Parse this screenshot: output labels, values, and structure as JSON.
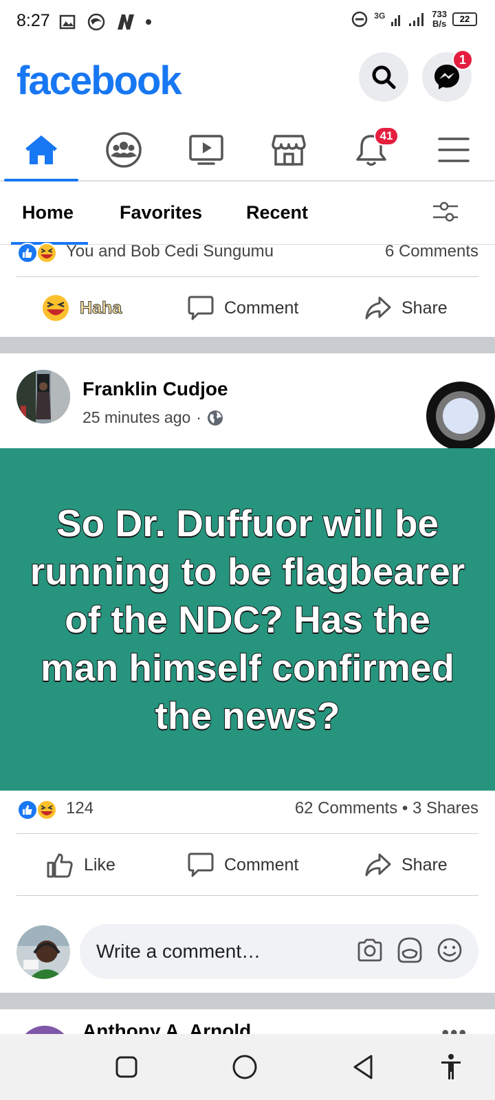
{
  "status_bar": {
    "time": "8:27",
    "network": "3G",
    "speed_value": "733",
    "speed_unit": "B/s",
    "battery": "22"
  },
  "header": {
    "logo": "facebook",
    "messenger_badge": "1",
    "brand_color": "#1877f2"
  },
  "nav": {
    "notifications_badge": "41",
    "icons": [
      "home-icon",
      "groups-icon",
      "watch-icon",
      "marketplace-icon",
      "bell-icon",
      "menu-icon"
    ]
  },
  "feed_tabs": {
    "home": "Home",
    "favorites": "Favorites",
    "recent": "Recent"
  },
  "previous_post": {
    "reactors": "You and Bob Cedi Sungumu",
    "comments": "6 Comments",
    "reaction_label": "Haha",
    "comment_label": "Comment",
    "share_label": "Share"
  },
  "post": {
    "author": "Franklin Cudjoe",
    "time": "25 minutes ago",
    "separator": "·",
    "text": "So Dr. Duffuor will be running to be flagbearer of the NDC? Has the man himself confirmed the news?",
    "background_color": "#27947e",
    "reaction_count": "124",
    "comments_shares": "62 Comments • 3 Shares",
    "like_label": "Like",
    "comment_label": "Comment",
    "share_label": "Share",
    "comment_placeholder": "Write a comment…"
  },
  "next_post": {
    "author": "Anthony A. Arnold"
  }
}
